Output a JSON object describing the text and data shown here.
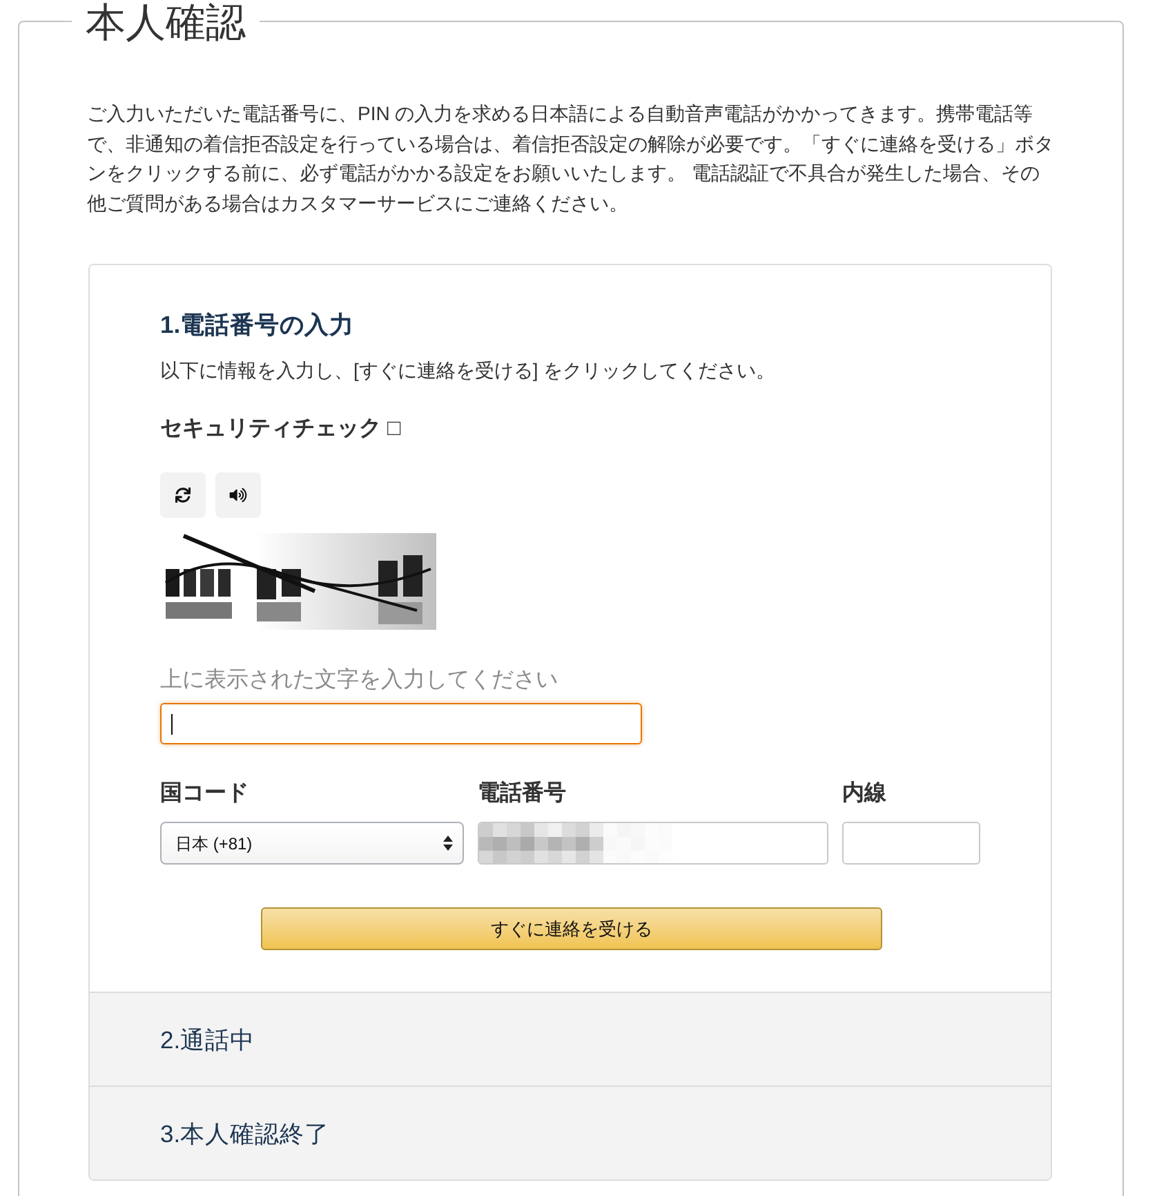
{
  "page_title": "本人確認",
  "intro": "ご入力いただいた電話番号に、PIN の入力を求める日本語による自動音声電話がかかってきます。携帯電話等で、非通知の着信拒否設定を行っている場合は、着信拒否設定の解除が必要です。「すぐに連絡を受ける」ボタンをクリックする前に、必ず電話がかかる設定をお願いいたします。 電話認証で不具合が発生した場合、その他ご質問がある場合はカスタマーサービスにご連絡ください。",
  "steps": [
    {
      "title": "1.電話番号の入力",
      "expanded": true,
      "form": {
        "instruction": "以下に情報を入力し、[すぐに連絡を受ける] をクリックしてください。",
        "security_check": "セキュリティチェック □",
        "captcha_prompt": "上に表示された文字を入力してください",
        "captcha_input": {
          "focused": true
        },
        "fields": [
          {
            "label": "国コード",
            "kind": "select",
            "value": "日本 (+81)"
          },
          {
            "label": "電話番号",
            "kind": "text",
            "redacted": true
          },
          {
            "label": "内線",
            "kind": "text",
            "redacted": false
          }
        ],
        "submit": "すぐに連絡を受ける"
      }
    },
    {
      "title": "2.通話中",
      "expanded": false
    },
    {
      "title": "3.本人確認終了",
      "expanded": false
    }
  ]
}
